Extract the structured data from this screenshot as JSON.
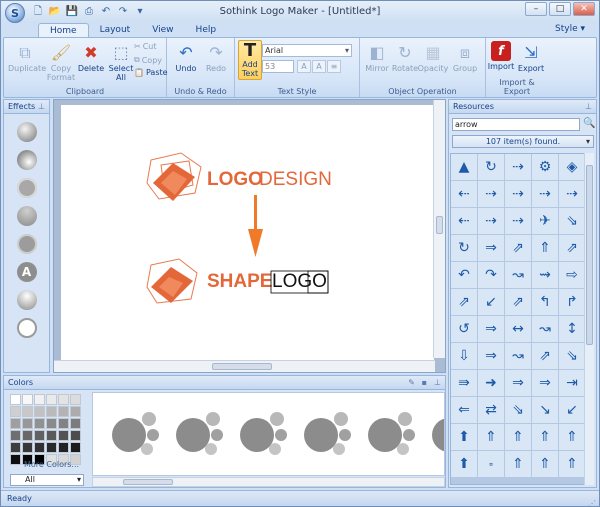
{
  "window": {
    "title": "Sothink Logo Maker - [Untitled*]",
    "style_link": "Style"
  },
  "tabs": [
    "Home",
    "Layout",
    "View",
    "Help"
  ],
  "ribbon": {
    "clipboard": {
      "label": "Clipboard",
      "duplicate": "Duplicate",
      "copy_format": "Copy Format",
      "delete": "Delete",
      "select_all": "Select All",
      "cut": "Cut",
      "copy": "Copy",
      "paste": "Paste"
    },
    "undo_redo": {
      "label": "Undo & Redo",
      "undo": "Undo",
      "redo": "Redo"
    },
    "text_style": {
      "label": "Text Style",
      "add_text": "Add Text",
      "font": "Arial",
      "size": "53"
    },
    "object_operation": {
      "label": "Object Operation",
      "mirror": "Mirror",
      "rotate": "Rotate",
      "opacity": "Opacity",
      "group": "Group"
    },
    "import_export": {
      "label": "Import & Export",
      "import": "Import",
      "export": "Export"
    }
  },
  "effects": {
    "title": "Effects"
  },
  "canvas": {
    "logo1_a": "LOGO",
    "logo1_b": "DESIGN",
    "logo2_a": "SHAPE",
    "logo2_b": "LOGO"
  },
  "resources": {
    "title": "Resources",
    "search": "arrow",
    "found": "107 item(s) found.",
    "icons": [
      "▲",
      "↻",
      "⇢",
      "⚙",
      "◈",
      "⇠",
      "⇢",
      "⇢",
      "⇢",
      "⇢",
      "⇠",
      "⇢",
      "⇢",
      "✈",
      "⇘",
      "↻",
      "⇒",
      "⇗",
      "⇑",
      "⇗",
      "↶",
      "↷",
      "↝",
      "⇝",
      "⇨",
      "⇗",
      "↙",
      "⇗",
      "↰",
      "↱",
      "↺",
      "⇒",
      "↔",
      "↝",
      "↕",
      "⇩",
      "⇒",
      "↝",
      "⇗",
      "⇘",
      "⇛",
      "➜",
      "⇒",
      "⇒",
      "⇥",
      "⇐",
      "⇄",
      "⇘",
      "↘",
      "↙",
      "⬆",
      "⇑",
      "⇑",
      "⇑",
      "⇑",
      "⬆",
      "⬞",
      "⇑",
      "⇑",
      "⇑"
    ]
  },
  "colors": {
    "title": "Colors",
    "more": "More Colors...",
    "filter": "All"
  },
  "status": {
    "text": "Ready"
  }
}
